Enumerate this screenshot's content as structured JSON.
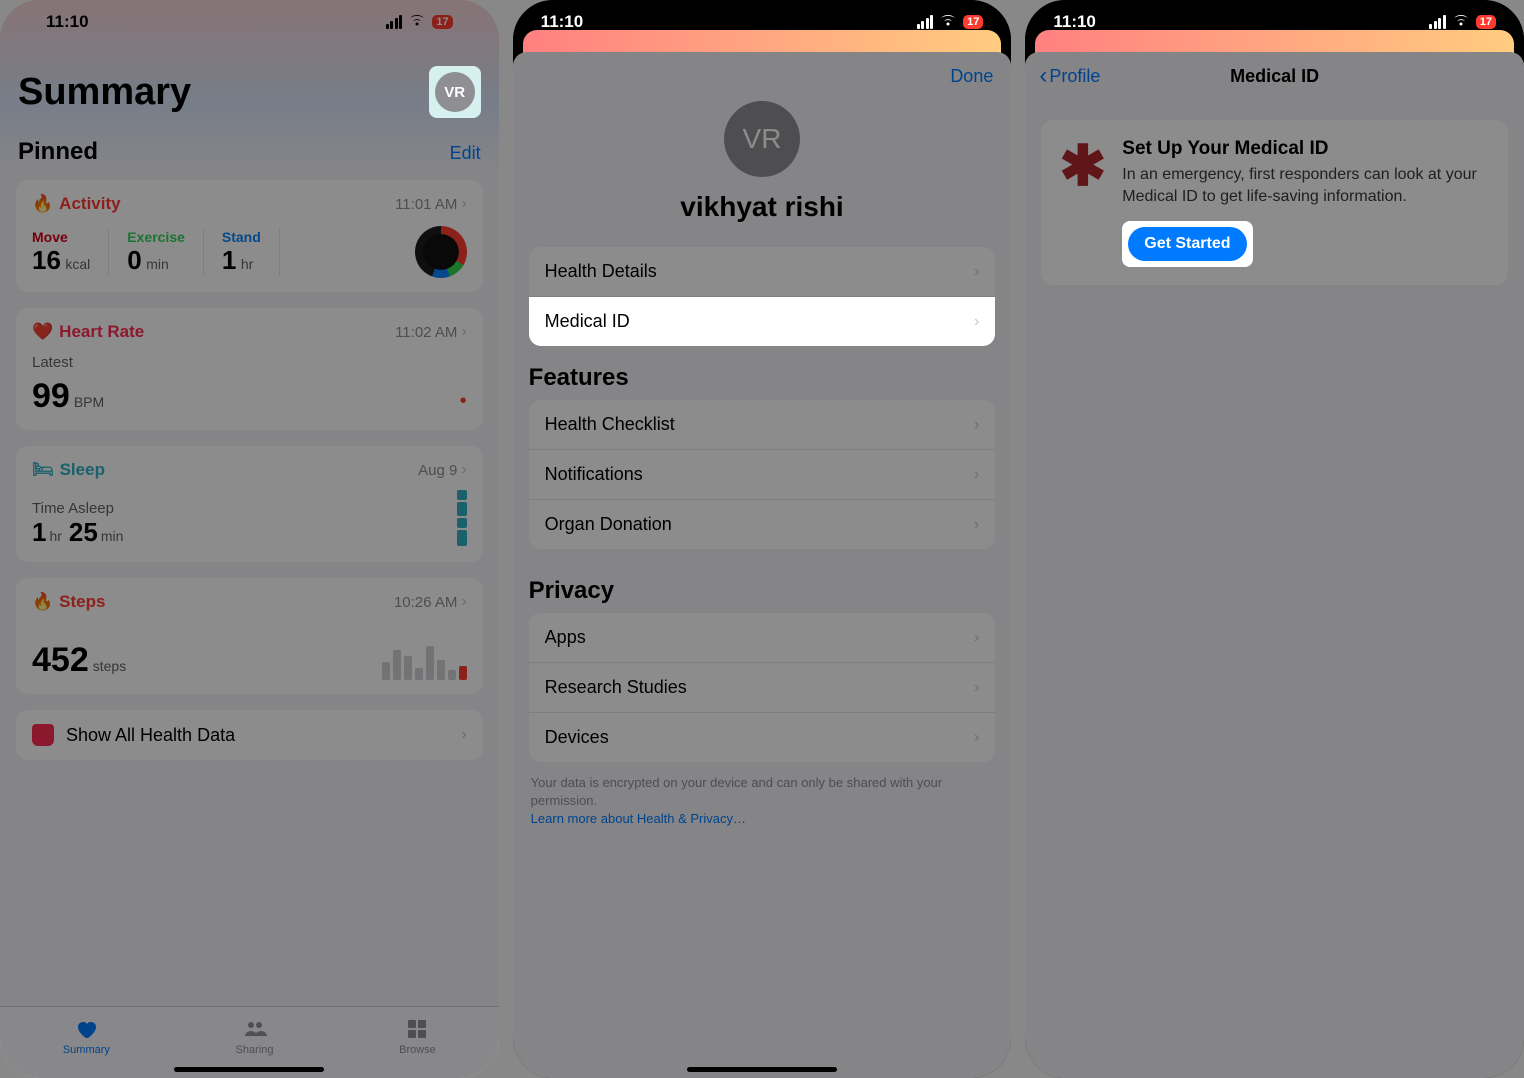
{
  "status": {
    "time": "11:10",
    "battery": "17"
  },
  "s1": {
    "title": "Summary",
    "pinned": "Pinned",
    "edit": "Edit",
    "avatar": "VR",
    "activity": {
      "label": "Activity",
      "time": "11:01 AM",
      "move_label": "Move",
      "move_val": "16",
      "move_unit": "kcal",
      "exercise_label": "Exercise",
      "exercise_val": "0",
      "exercise_unit": "min",
      "stand_label": "Stand",
      "stand_val": "1",
      "stand_unit": "hr"
    },
    "heart": {
      "label": "Heart Rate",
      "time": "11:02 AM",
      "latest": "Latest",
      "val": "99",
      "unit": "BPM"
    },
    "sleep": {
      "label": "Sleep",
      "time": "Aug 9",
      "metric": "Time Asleep",
      "h_val": "1",
      "h_unit": "hr",
      "m_val": "25",
      "m_unit": "min"
    },
    "steps": {
      "label": "Steps",
      "time": "10:26 AM",
      "val": "452",
      "unit": "steps"
    },
    "all_health": "Show All Health Data",
    "tabs": {
      "summary": "Summary",
      "sharing": "Sharing",
      "browse": "Browse"
    }
  },
  "s2": {
    "done": "Done",
    "avatar": "VR",
    "name": "vikhyat rishi",
    "rows": {
      "health_details": "Health Details",
      "medical_id": "Medical ID"
    },
    "features_hdr": "Features",
    "features": {
      "checklist": "Health Checklist",
      "notifications": "Notifications",
      "organ": "Organ Donation"
    },
    "privacy_hdr": "Privacy",
    "privacy": {
      "apps": "Apps",
      "research": "Research Studies",
      "devices": "Devices"
    },
    "foot1": "Your data is encrypted on your device and can only be shared with your permission.",
    "foot_link": "Learn more about Health & Privacy…"
  },
  "s3": {
    "back": "Profile",
    "title": "Medical ID",
    "card_title": "Set Up Your Medical ID",
    "card_desc": "In an emergency, first responders can look at your Medical ID to get life-saving information.",
    "button": "Get Started"
  },
  "colors": {
    "activity": "#ff3b30",
    "move": "#d70015",
    "exercise": "#30d158",
    "stand": "#0a84ff",
    "heart": "#ff2d55",
    "sleep": "#30b0c7",
    "link": "#007aff"
  }
}
